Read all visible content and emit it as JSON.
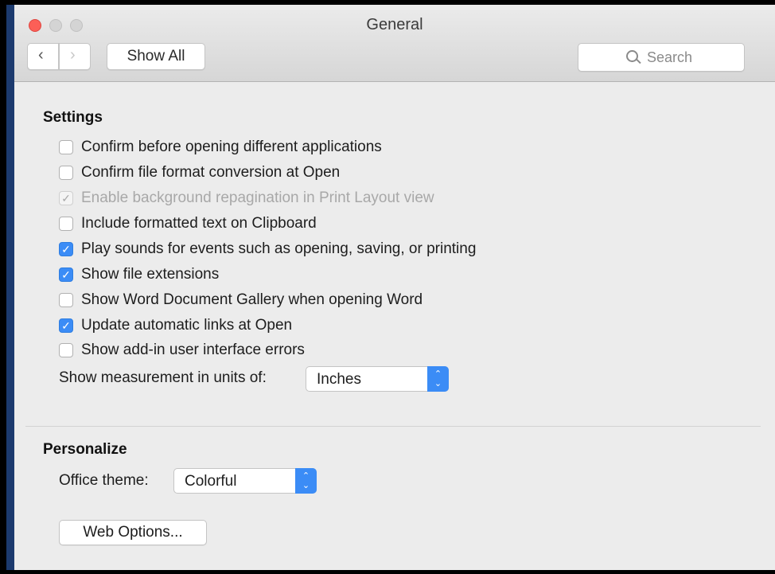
{
  "window": {
    "title": "General"
  },
  "toolbar": {
    "back_icon": "chevron-left-icon",
    "forward_icon": "chevron-right-icon",
    "show_all": "Show All",
    "search_placeholder": "Search"
  },
  "settings": {
    "heading": "Settings",
    "checkboxes": [
      {
        "label": "Confirm before opening different applications",
        "checked": false,
        "enabled": true
      },
      {
        "label": "Confirm file format conversion at Open",
        "checked": false,
        "enabled": true
      },
      {
        "label": "Enable background repagination in Print Layout view",
        "checked": true,
        "enabled": false
      },
      {
        "label": "Include formatted text on Clipboard",
        "checked": false,
        "enabled": true
      },
      {
        "label": "Play sounds for events such as opening, saving, or printing",
        "checked": true,
        "enabled": true
      },
      {
        "label": "Show file extensions",
        "checked": true,
        "enabled": true
      },
      {
        "label": "Show Word Document Gallery when opening Word",
        "checked": false,
        "enabled": true
      },
      {
        "label": "Update automatic links at Open",
        "checked": true,
        "enabled": true
      },
      {
        "label": "Show add-in user interface errors",
        "checked": false,
        "enabled": true
      }
    ],
    "measurement_label": "Show measurement in units of:",
    "measurement_value": "Inches"
  },
  "personalize": {
    "heading": "Personalize",
    "theme_label": "Office theme:",
    "theme_value": "Colorful",
    "web_options": "Web Options..."
  },
  "colors": {
    "accent": "#3b8cf6",
    "close": "#fc5f57"
  }
}
